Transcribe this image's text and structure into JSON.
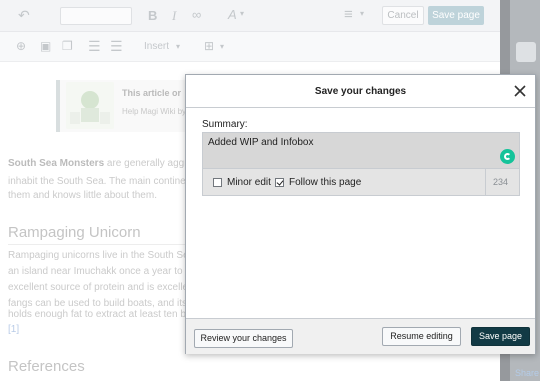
{
  "toolbar": {
    "cancel_label": "Cancel",
    "save_label": "Save page",
    "insert_label": "Insert"
  },
  "article": {
    "notice_title": "This article or",
    "notice_text": "Help Magi Wiki by",
    "intro_bold": "South Sea Monsters",
    "intro_rest": " are generally aggr",
    "intro_line2": "inhabit the South Sea. The main continer",
    "intro_line3": "them and knows little about them.",
    "heading1": "Rampaging Unicorn",
    "para2_lines": [
      "Rampaging unicorns live in the South Se",
      "an island near Imuchakk once a year to b",
      "excellent source of protein and is excelle",
      "fangs can be used to build boats, and its",
      "holds enough fat to extract at least ten bu"
    ],
    "cite": "[1]",
    "heading2": "References",
    "share": "Share"
  },
  "dialog": {
    "title": "Save your changes",
    "summary_label": "Summary:",
    "summary_value": "Added WIP and Infobox",
    "minor_edit_label": "Minor edit",
    "minor_edit_checked": false,
    "follow_label": "Follow this page",
    "follow_checked": true,
    "char_count": "234",
    "review_label": "Review your changes",
    "resume_label": "Resume editing",
    "save_label": "Save page"
  },
  "colors": {
    "save_primary": "#123a45",
    "grammarly": "#15c39a",
    "save_page_toolbar": "#8fb3bf"
  }
}
